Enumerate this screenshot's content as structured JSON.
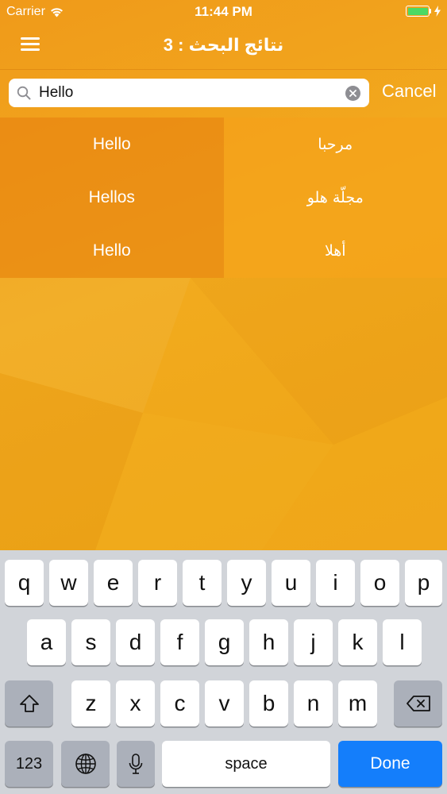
{
  "status_bar": {
    "carrier": "Carrier",
    "time": "11:44 PM"
  },
  "nav": {
    "title": "نتائج البحث : 3"
  },
  "search": {
    "value": "Hello",
    "cancel_label": "Cancel"
  },
  "results": {
    "english": [
      "Hello",
      "Hellos",
      "Hello"
    ],
    "arabic": [
      "مرحبا",
      "مجلّة هلو",
      "أهلا"
    ]
  },
  "keyboard": {
    "row1": [
      "q",
      "w",
      "e",
      "r",
      "t",
      "y",
      "u",
      "i",
      "o",
      "p"
    ],
    "row2": [
      "a",
      "s",
      "d",
      "f",
      "g",
      "h",
      "j",
      "k",
      "l"
    ],
    "row3": [
      "z",
      "x",
      "c",
      "v",
      "b",
      "n",
      "m"
    ],
    "numbers_label": "123",
    "space_label": "space",
    "done_label": "Done"
  },
  "colors": {
    "accent": "#f2a217",
    "done_key": "#147efb",
    "battery": "#4cd964"
  },
  "icons": [
    "wifi-icon",
    "battery-icon",
    "hamburger-menu-icon",
    "search-icon",
    "clear-icon",
    "shift-icon",
    "backspace-icon",
    "globe-icon",
    "microphone-icon"
  ]
}
